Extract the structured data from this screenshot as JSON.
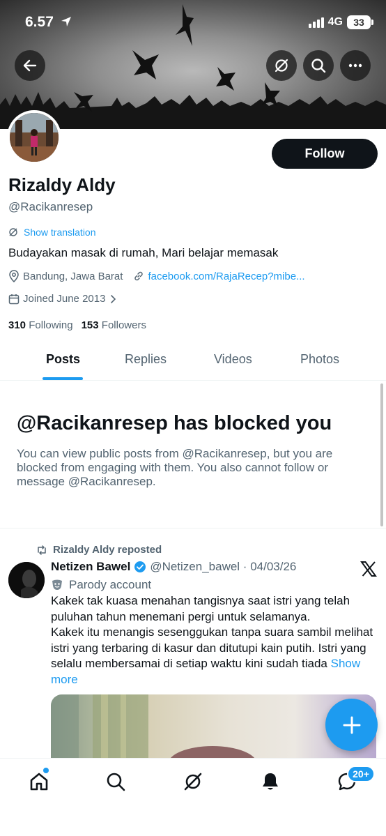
{
  "status_bar": {
    "time": "6.57",
    "network": "4G",
    "battery": "33"
  },
  "profile": {
    "name": "Rizaldy Aldy",
    "handle": "@Racikanresep",
    "follow_label": "Follow",
    "show_translation": "Show translation",
    "bio": "Budayakan masak di rumah, Mari belajar memasak",
    "location": "Bandung, Jawa Barat",
    "link": "facebook.com/RajaRecep?mibe...",
    "joined": "Joined June 2013",
    "following_count": "310",
    "following_label": "Following",
    "followers_count": "153",
    "followers_label": "Followers"
  },
  "tabs": [
    "Posts",
    "Replies",
    "Videos",
    "Photos"
  ],
  "blocked": {
    "title": "@Racikanresep has blocked you",
    "text": "You can view public posts from @Racikanresep, but you are blocked from engaging with them. You also cannot follow or message @Racikanresep."
  },
  "post": {
    "repost_label": "Rizaldy Aldy reposted",
    "author_name": "Netizen Bawel",
    "author_meta": "@Netizen_bawel · 04/03/26",
    "parody_label": "Parody account",
    "text": "Kakek tak kuasa menahan tangisnya saat istri yang telah puluhan tahun menemani pergi untuk selamanya.\nKakek itu menangis sesenggukan tanpa suara sambil melihat istri yang terbaring di kasur dan ditutupi kain putih. Istri yang selalu membersamai di setiap waktu kini sudah tiada",
    "show_more": "Show more"
  },
  "bottom_nav": {
    "messages_badge": "20+"
  },
  "colors": {
    "accent": "#1d9bf0",
    "text": "#0f1419",
    "secondary": "#536471"
  },
  "icons": [
    "back-arrow-icon",
    "grok-icon",
    "search-icon",
    "more-icon",
    "translate-icon",
    "location-icon",
    "link-icon",
    "calendar-icon",
    "chevron-right-icon",
    "repost-icon",
    "verified-icon",
    "parody-mask-icon",
    "x-logo-icon",
    "plus-icon",
    "home-icon",
    "notifications-icon",
    "messages-icon"
  ]
}
